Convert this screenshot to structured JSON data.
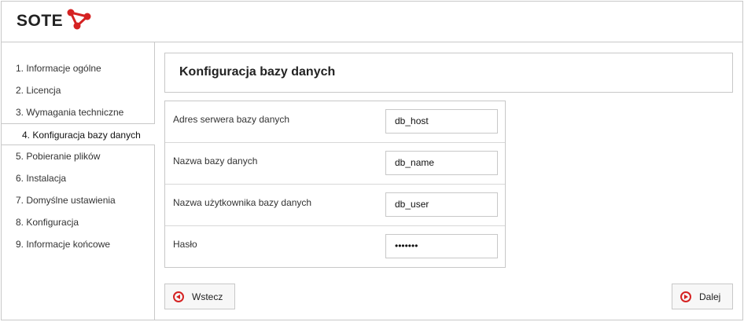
{
  "brand": {
    "name": "SOTE",
    "accent_color": "#d52222"
  },
  "steps": [
    {
      "label": "1. Informacje ogólne"
    },
    {
      "label": "2. Licencja"
    },
    {
      "label": "3. Wymagania techniczne"
    },
    {
      "label": "4. Konfiguracja bazy danych",
      "active": true
    },
    {
      "label": "5. Pobieranie plików"
    },
    {
      "label": "6. Instalacja"
    },
    {
      "label": "7. Domyślne ustawienia"
    },
    {
      "label": "8. Konfiguracja"
    },
    {
      "label": "9. Informacje końcowe"
    }
  ],
  "page": {
    "title": "Konfiguracja bazy danych"
  },
  "form": {
    "fields": [
      {
        "label": "Adres serwera bazy danych",
        "value": "db_host"
      },
      {
        "label": "Nazwa bazy danych",
        "value": "db_name"
      },
      {
        "label": "Nazwa użytkownika bazy danych",
        "value": "db_user"
      },
      {
        "label": "Hasło",
        "value": "•••••••"
      }
    ]
  },
  "buttons": {
    "back_label": "Wstecz",
    "next_label": "Dalej"
  }
}
